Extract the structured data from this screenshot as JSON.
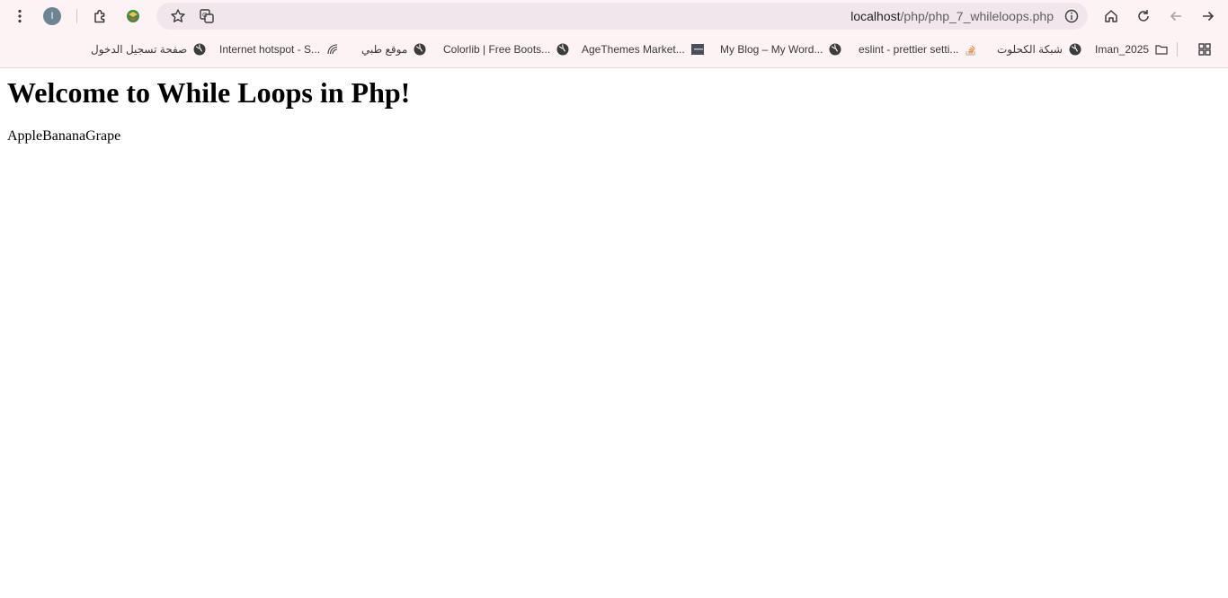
{
  "browser": {
    "profile_initial": "I",
    "url_host": "localhost",
    "url_path": "/php/php_7_whileloops.php",
    "colors": {
      "chrome_bg": "#fdf3f5",
      "omnibox_bg": "#f0e6ec",
      "profile_bg": "#6d8593"
    }
  },
  "toolbar_icons": [
    "menu-dots-icon",
    "extensions-icon",
    "vpn-extension-icon",
    "bookmark-star-icon",
    "translate-icon",
    "site-info-icon",
    "home-icon",
    "reload-icon",
    "back-icon",
    "forward-icon",
    "apps-grid-icon"
  ],
  "bookmarks": [
    {
      "label": "Iman_2025",
      "icon": "folder-icon"
    },
    {
      "label": "شبكة الكحلوت",
      "icon": "globe-icon"
    },
    {
      "label": "eslint - prettier setti...",
      "icon": "stack-overflow-icon"
    },
    {
      "label": "My Blog – My Word...",
      "icon": "globe-icon"
    },
    {
      "label": "AgeThemes Market...",
      "icon": "agethemes-icon"
    },
    {
      "label": "Colorlib | Free Boots...",
      "icon": "globe-icon"
    },
    {
      "label": "موقع طبي",
      "icon": "globe-icon"
    },
    {
      "label": "Internet hotspot - S...",
      "icon": "hotspot-icon"
    },
    {
      "label": "صفحة تسجيل الدخول",
      "icon": "globe-icon"
    }
  ],
  "page": {
    "heading": "Welcome to While Loops in Php!",
    "output": "AppleBananaGrape"
  }
}
